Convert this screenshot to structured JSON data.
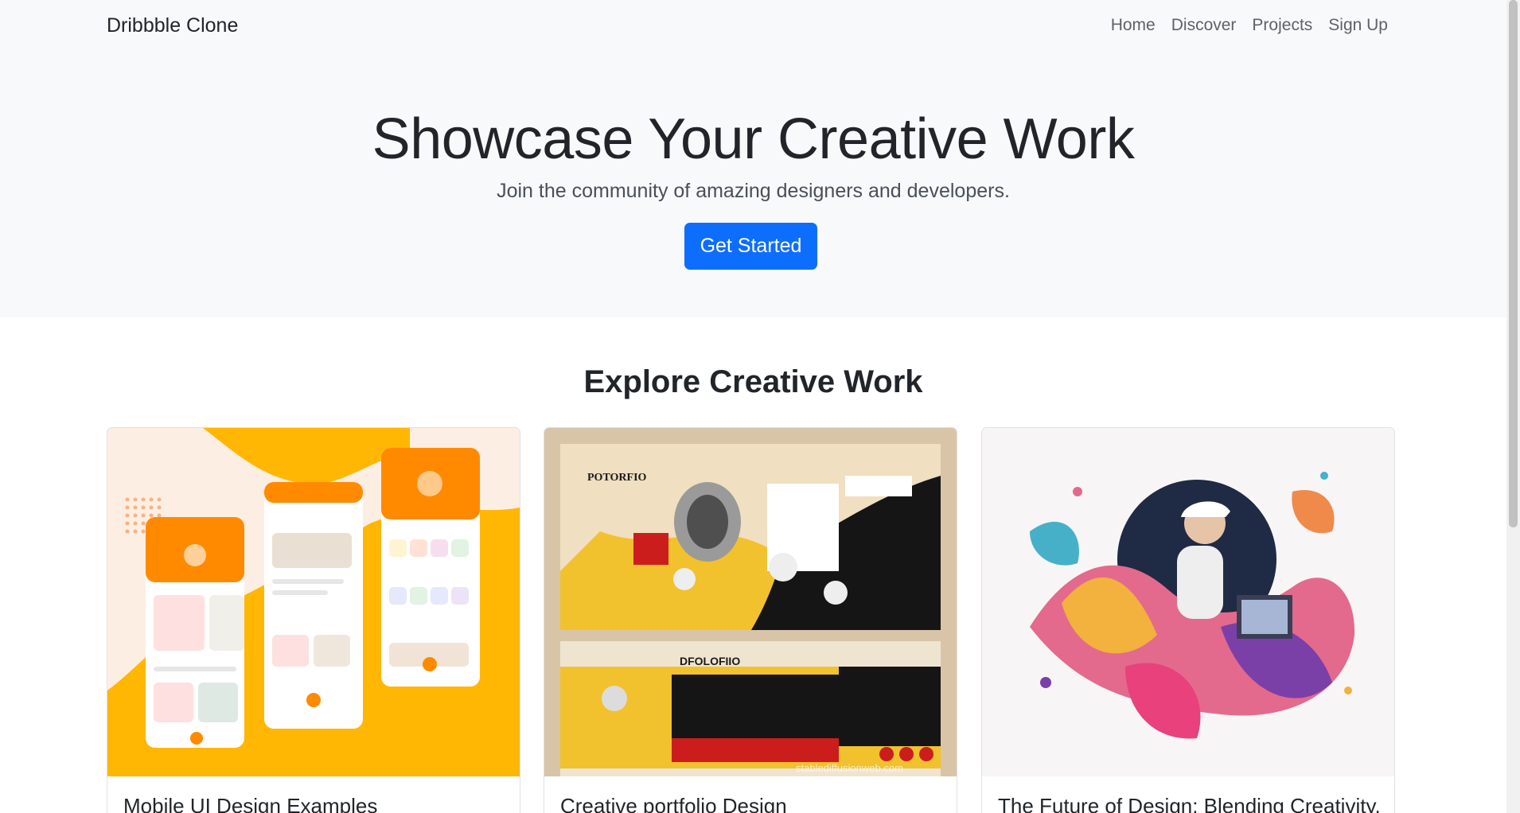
{
  "navbar": {
    "brand": "Dribbble Clone",
    "links": [
      "Home",
      "Discover",
      "Projects",
      "Sign Up"
    ]
  },
  "hero": {
    "title": "Showcase Your Creative Work",
    "subtitle": "Join the community of amazing designers and developers.",
    "cta_label": "Get Started"
  },
  "section": {
    "title": "Explore Creative Work"
  },
  "cards": [
    {
      "title": "Mobile UI Design Examples"
    },
    {
      "title": "Creative portfolio Design",
      "brand_top": "POTORFIO",
      "brand_bottom": "DFOLOFIIO",
      "watermark": "stablediffusionweb.com"
    },
    {
      "title": "The Future of Design: Blending Creativity,"
    }
  ],
  "colors": {
    "accent": "#0d6efd",
    "navbar_bg": "#f8f9fa",
    "card_orange": "#ffb703",
    "card_yellow": "#f2c12e"
  }
}
